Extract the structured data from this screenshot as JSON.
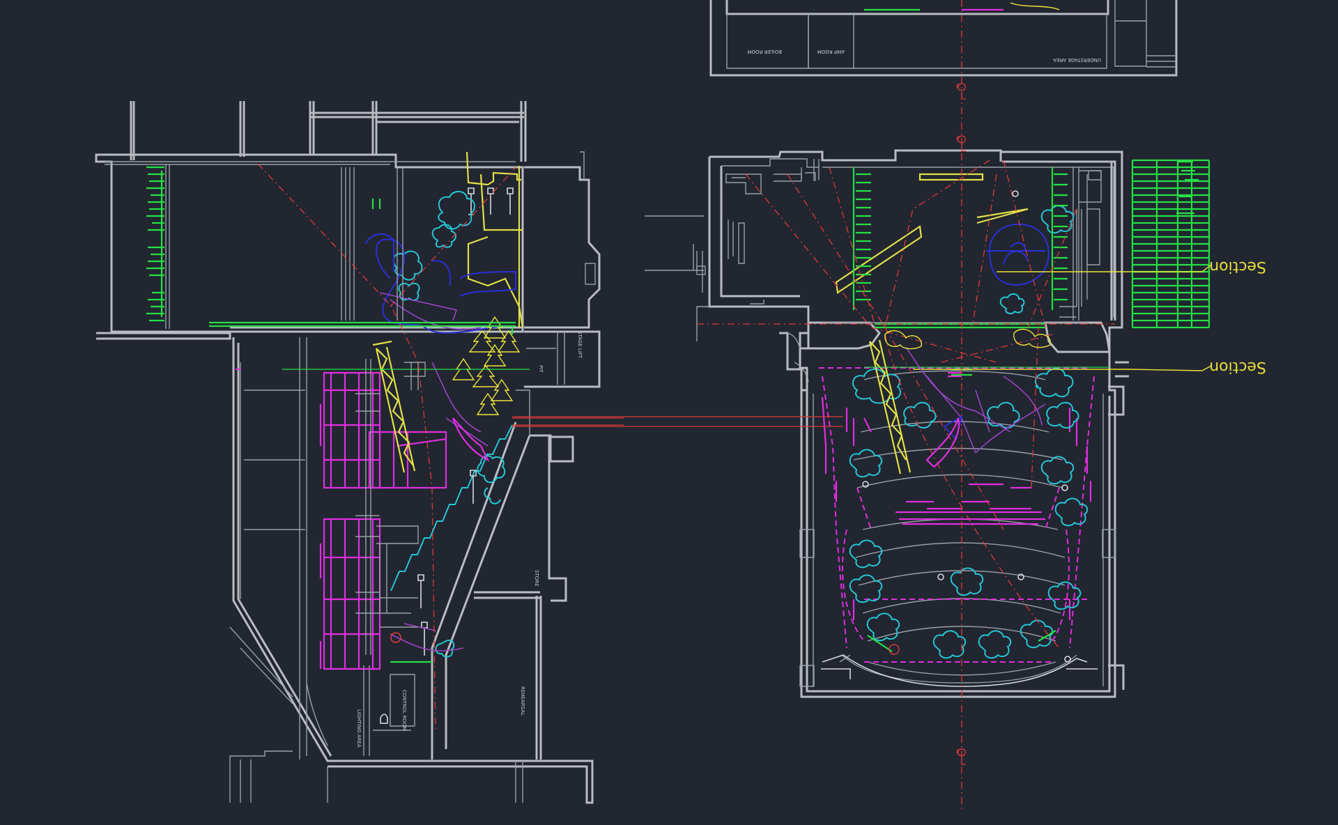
{
  "drawing": {
    "section_label_upper": "Section",
    "section_label_lower": "Section",
    "room_labels": {
      "boiler_room": "BOILER ROOM",
      "amp_room": "AMP ROOM",
      "understage_area": "UNDERSTAGE AREA",
      "control_room": "CONTROL ROOM",
      "lighting_area": "LIGHTING AREA",
      "rehearsal": "REHEARSAL",
      "store": "STORE",
      "stage_lift": "STAGE LIFT",
      "pit": "PIT"
    }
  },
  "colors": {
    "background": "#212630",
    "walls": "#b9bcc2",
    "centerline": "#e03a3a",
    "scenery_cyan": "#26c6d6",
    "scenery_blue": "#2b2fd8",
    "seating_magenta": "#e12ee0",
    "lighting_green": "#26e046",
    "truss_yellow": "#e3e046",
    "label_yellow": "#e8df3c"
  }
}
